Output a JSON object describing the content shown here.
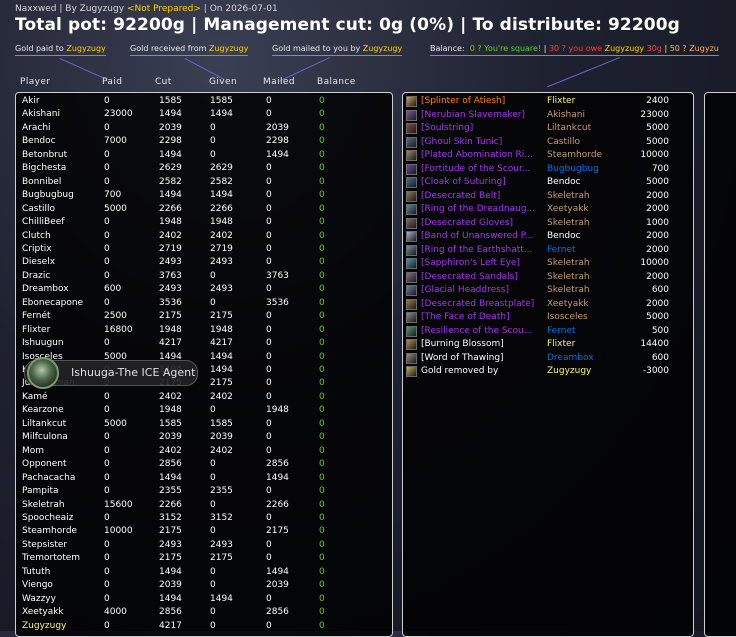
{
  "header": {
    "raid": "Naxxwed",
    "by_label": "By",
    "author": "Zugyzugy",
    "status": "<Not Prepared>",
    "date_label": "On",
    "date": "2026-07-01",
    "title": "Total pot: 92200g | Management cut: 0g (0%) | To distribute: 92200g"
  },
  "legend": {
    "paid_label": "Gold paid to",
    "paid_name": "Zugyzugy",
    "received_label": "Gold received from",
    "received_name": "Zugyzugy",
    "mailed_label": "Gold mailed to you by",
    "mailed_name": "Zugyzugy",
    "balance_label": "Balance:",
    "balance_square": "0 ? You're square!",
    "balance_sep1": "|",
    "balance_owe": "30 ? you owe",
    "balance_owe_name": "Zugyzugy",
    "balance_owe_amount": "30g",
    "balance_sep2": "|",
    "balance_next": "50 ? Zugyzu"
  },
  "columns": {
    "player": "Player",
    "paid": "Paid",
    "cut": "Cut",
    "given": "Given",
    "mailed": "Mailed",
    "balance": "Balance"
  },
  "players": [
    {
      "name": "Akir",
      "paid": "0",
      "cut": "1585",
      "given": "1585",
      "mailed": "0",
      "balance": "0"
    },
    {
      "name": "Akishani",
      "paid": "23000",
      "cut": "1494",
      "given": "1494",
      "mailed": "0",
      "balance": "0"
    },
    {
      "name": "Arachi",
      "paid": "0",
      "cut": "2039",
      "given": "0",
      "mailed": "2039",
      "balance": "0"
    },
    {
      "name": "Bendoc",
      "paid": "7000",
      "cut": "2298",
      "given": "0",
      "mailed": "2298",
      "balance": "0"
    },
    {
      "name": "Betonbrut",
      "paid": "0",
      "cut": "1494",
      "given": "0",
      "mailed": "1494",
      "balance": "0"
    },
    {
      "name": "Bigchesta",
      "paid": "0",
      "cut": "2629",
      "given": "2629",
      "mailed": "0",
      "balance": "0"
    },
    {
      "name": "Bonnibel",
      "paid": "0",
      "cut": "2582",
      "given": "2582",
      "mailed": "0",
      "balance": "0"
    },
    {
      "name": "Bugbugbug",
      "paid": "700",
      "cut": "1494",
      "given": "1494",
      "mailed": "0",
      "balance": "0"
    },
    {
      "name": "Castillo",
      "paid": "5000",
      "cut": "2266",
      "given": "2266",
      "mailed": "0",
      "balance": "0"
    },
    {
      "name": "ChilliBeef",
      "paid": "0",
      "cut": "1948",
      "given": "1948",
      "mailed": "0",
      "balance": "0"
    },
    {
      "name": "Clutch",
      "paid": "0",
      "cut": "2402",
      "given": "2402",
      "mailed": "0",
      "balance": "0"
    },
    {
      "name": "Criptix",
      "paid": "0",
      "cut": "2719",
      "given": "2719",
      "mailed": "0",
      "balance": "0"
    },
    {
      "name": "Dieselx",
      "paid": "0",
      "cut": "2493",
      "given": "2493",
      "mailed": "0",
      "balance": "0"
    },
    {
      "name": "Drazic",
      "paid": "0",
      "cut": "3763",
      "given": "0",
      "mailed": "3763",
      "balance": "0"
    },
    {
      "name": "Dreambox",
      "paid": "600",
      "cut": "2493",
      "given": "2493",
      "mailed": "0",
      "balance": "0"
    },
    {
      "name": "Ebonecapone",
      "paid": "0",
      "cut": "3536",
      "given": "0",
      "mailed": "3536",
      "balance": "0"
    },
    {
      "name": "Fernét",
      "paid": "2500",
      "cut": "2175",
      "given": "2175",
      "mailed": "0",
      "balance": "0"
    },
    {
      "name": "Flixter",
      "paid": "16800",
      "cut": "1948",
      "given": "1948",
      "mailed": "0",
      "balance": "0"
    },
    {
      "name": "Ishuugun",
      "paid": "0",
      "cut": "4217",
      "given": "4217",
      "mailed": "0",
      "balance": "0"
    },
    {
      "name": "Isosceles",
      "paid": "5000",
      "cut": "1494",
      "given": "1494",
      "mailed": "0",
      "balance": "0"
    },
    {
      "name": "Ka",
      "paid": "0",
      "cut": "1494",
      "given": "1494",
      "mailed": "0",
      "balance": "0"
    },
    {
      "name": "Ju    eshaman",
      "paid": "0",
      "cut": "2175",
      "given": "2175",
      "mailed": "0",
      "balance": "0"
    },
    {
      "name": "Kamé",
      "paid": "0",
      "cut": "2402",
      "given": "2402",
      "mailed": "0",
      "balance": "0"
    },
    {
      "name": "Kearzone",
      "paid": "0",
      "cut": "1948",
      "given": "0",
      "mailed": "1948",
      "balance": "0"
    },
    {
      "name": "Liltankcut",
      "paid": "5000",
      "cut": "1585",
      "given": "1585",
      "mailed": "0",
      "balance": "0"
    },
    {
      "name": "Milfculona",
      "paid": "0",
      "cut": "2039",
      "given": "2039",
      "mailed": "0",
      "balance": "0"
    },
    {
      "name": "Mom",
      "paid": "0",
      "cut": "2402",
      "given": "2402",
      "mailed": "0",
      "balance": "0"
    },
    {
      "name": "Opponent",
      "paid": "0",
      "cut": "2856",
      "given": "0",
      "mailed": "2856",
      "balance": "0"
    },
    {
      "name": "Pachacacha",
      "paid": "0",
      "cut": "1494",
      "given": "0",
      "mailed": "1494",
      "balance": "0"
    },
    {
      "name": "Pampita",
      "paid": "0",
      "cut": "2355",
      "given": "2355",
      "mailed": "0",
      "balance": "0"
    },
    {
      "name": "Skeletrah",
      "paid": "15600",
      "cut": "2266",
      "given": "0",
      "mailed": "2266",
      "balance": "0"
    },
    {
      "name": "Spoocheaiz",
      "paid": "0",
      "cut": "3152",
      "given": "3152",
      "mailed": "0",
      "balance": "0"
    },
    {
      "name": "Steamhorde",
      "paid": "10000",
      "cut": "2175",
      "given": "0",
      "mailed": "2175",
      "balance": "0"
    },
    {
      "name": "Stepsister",
      "paid": "0",
      "cut": "2493",
      "given": "2493",
      "mailed": "0",
      "balance": "0"
    },
    {
      "name": "Tremortotem",
      "paid": "0",
      "cut": "2175",
      "given": "2175",
      "mailed": "0",
      "balance": "0"
    },
    {
      "name": "Tututh",
      "paid": "0",
      "cut": "1494",
      "given": "0",
      "mailed": "1494",
      "balance": "0"
    },
    {
      "name": "Viengo",
      "paid": "0",
      "cut": "2039",
      "given": "0",
      "mailed": "2039",
      "balance": "0"
    },
    {
      "name": "Wazzyy",
      "paid": "0",
      "cut": "1494",
      "given": "1494",
      "mailed": "0",
      "balance": "0"
    },
    {
      "name": "Xeetyakk",
      "paid": "4000",
      "cut": "2856",
      "given": "0",
      "mailed": "2856",
      "balance": "0"
    },
    {
      "name": "Zugyzugy",
      "paid": "0",
      "cut": "4217",
      "given": "0",
      "mailed": "0",
      "balance": "0",
      "highlight": true
    }
  ],
  "items": [
    {
      "item": "[Splinter of Atiesh]",
      "quality": "legendary",
      "winner": "Flixter",
      "winner_class": "rogue",
      "price": "2400",
      "icon": "splinter-icon"
    },
    {
      "item": "[Nerubian Slavemaker]",
      "quality": "epic",
      "winner": "Akishani",
      "winner_class": "warrior",
      "price": "23000",
      "icon": "crossbow-icon"
    },
    {
      "item": "[Soulstring]",
      "quality": "epic",
      "winner": "Liltankcut",
      "winner_class": "warrior",
      "price": "5000",
      "icon": "bow-icon"
    },
    {
      "item": "[Ghoul Skin Tunic]",
      "quality": "epic",
      "winner": "Castillo",
      "winner_class": "warrior",
      "price": "5000",
      "icon": "tunic-icon"
    },
    {
      "item": "[Plated Abomination Ri...",
      "quality": "epic",
      "winner": "Steamhorde",
      "winner_class": "warrior",
      "price": "10000",
      "icon": "ring-icon"
    },
    {
      "item": "[Fortitude of the Scour...",
      "quality": "epic",
      "winner": "Bugbugbug",
      "winner_class": "shaman",
      "price": "700",
      "icon": "helm-icon"
    },
    {
      "item": "[Cloak of Suturing]",
      "quality": "epic",
      "winner": "Bendoc",
      "winner_class": "neutral",
      "price": "5000",
      "icon": "cloak-icon"
    },
    {
      "item": "[Desecrated Belt]",
      "quality": "epic",
      "winner": "Skeletrah",
      "winner_class": "warrior",
      "price": "2000",
      "icon": "belt-icon"
    },
    {
      "item": "[Ring of the Dreadnaug...",
      "quality": "epic",
      "winner": "Xeetyakk",
      "winner_class": "warrior",
      "price": "2000",
      "icon": "ring-icon"
    },
    {
      "item": "[Desecrated Gloves]",
      "quality": "epic",
      "winner": "Skeletrah",
      "winner_class": "warrior",
      "price": "1000",
      "icon": "gloves-icon"
    },
    {
      "item": "[Band of Unanswered P...",
      "quality": "epic",
      "winner": "Bendoc",
      "winner_class": "neutral",
      "price": "2000",
      "icon": "band-icon"
    },
    {
      "item": "[Ring of the Earthshatt...",
      "quality": "epic",
      "winner": "Fernet",
      "winner_class": "shaman",
      "price": "2000",
      "icon": "ring-icon"
    },
    {
      "item": "[Sapphiron's Left Eye]",
      "quality": "epic",
      "winner": "Skeletrah",
      "winner_class": "warrior",
      "price": "10000",
      "icon": "eye-icon"
    },
    {
      "item": "[Desecrated Sandals]",
      "quality": "epic",
      "winner": "Skeletrah",
      "winner_class": "warrior",
      "price": "2000",
      "icon": "sandals-icon"
    },
    {
      "item": "[Glacial Headdress]",
      "quality": "epic",
      "winner": "Skeletrah",
      "winner_class": "warrior",
      "price": "600",
      "icon": "headdress-icon"
    },
    {
      "item": "[Desecrated Breastplate]",
      "quality": "epic",
      "winner": "Xeetyakk",
      "winner_class": "warrior",
      "price": "2000",
      "icon": "breastplate-icon"
    },
    {
      "item": "[The Face of Death]",
      "quality": "epic",
      "winner": "Isosceles",
      "winner_class": "warrior",
      "price": "5000",
      "icon": "shield-icon"
    },
    {
      "item": "[Resilience of the Scou...",
      "quality": "epic",
      "winner": "Fernet",
      "winner_class": "shaman",
      "price": "500",
      "icon": "resilience-icon"
    },
    {
      "item": "[Burning Blossom]",
      "quality": "common",
      "winner": "Flixter",
      "winner_class": "rogue",
      "price": "14400",
      "icon": "blossom-icon"
    },
    {
      "item": "[Word of Thawing]",
      "quality": "common",
      "winner": "Dreambox",
      "winner_class": "shaman",
      "price": "600",
      "icon": "scroll-icon"
    },
    {
      "item": "Gold removed by",
      "quality": "common",
      "winner": "Zugyzugy",
      "winner_class": "rogue",
      "price": "-3000",
      "icon": "gold-icon"
    }
  ],
  "tooltip": {
    "name": "Ishuuga-The ICE Agent"
  },
  "colors": {
    "legendary": "#ff8000",
    "epic": "#a335ee",
    "common": "#ffffff",
    "rogue": "#fff569",
    "warrior": "#c79c6e",
    "shaman": "#0070de",
    "neutral": "#ffffff",
    "balance_green": "#5cd11a",
    "accent": "#ffd100"
  }
}
